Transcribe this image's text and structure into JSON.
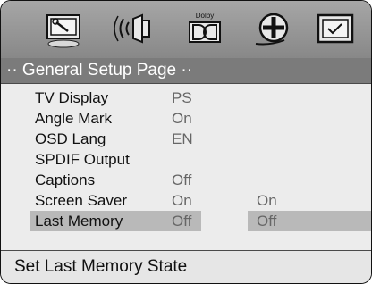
{
  "tabs": [
    {
      "icon": "wrench-icon"
    },
    {
      "icon": "speaker-audio-icon"
    },
    {
      "icon": "dolby-icon",
      "label": "Dolby"
    },
    {
      "icon": "film-reel-icon"
    },
    {
      "icon": "checkbox-preferences-icon"
    }
  ],
  "title": "·· General Setup Page ··",
  "settings": [
    {
      "label": "TV Display",
      "value": "PS",
      "option": ""
    },
    {
      "label": "Angle Mark",
      "value": "On",
      "option": ""
    },
    {
      "label": "OSD Lang",
      "value": "EN",
      "option": ""
    },
    {
      "label": "SPDIF Output",
      "value": "",
      "option": ""
    },
    {
      "label": "Captions",
      "value": "Off",
      "option": ""
    },
    {
      "label": "Screen Saver",
      "value": "On",
      "option": "On"
    },
    {
      "label": "Last Memory",
      "value": "Off",
      "option": "Off",
      "selected": true
    }
  ],
  "status": "Set Last Memory State",
  "colors": {
    "icon_bar": "#999999",
    "title_bar": "#7b7b7b",
    "panel": "#ececec",
    "highlight": "#b9b9b9"
  }
}
